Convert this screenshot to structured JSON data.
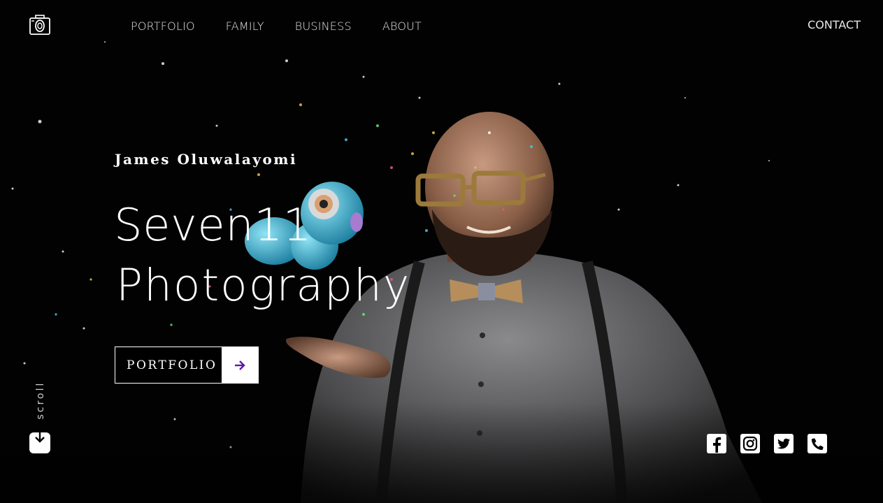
{
  "header": {
    "logo_icon": "camera-icon",
    "nav": [
      {
        "label": "PORTFOLIO"
      },
      {
        "label": "FAMILY"
      },
      {
        "label": "BUSINESS"
      },
      {
        "label": "ABOUT"
      }
    ],
    "contact_label": "CONTACT"
  },
  "hero": {
    "subtitle": "James Oluwalayomi",
    "title_line1": "Seven11",
    "title_line2": "Photography",
    "cta_label": "PORTFOLIO",
    "cta_icon": "arrow-right-icon",
    "accent_color": "#5b1aa6"
  },
  "scroll": {
    "label": "scroll",
    "icon": "arrow-down-icon"
  },
  "social": [
    {
      "name": "facebook-icon"
    },
    {
      "name": "instagram-icon"
    },
    {
      "name": "twitter-icon"
    },
    {
      "name": "phone-icon"
    }
  ]
}
